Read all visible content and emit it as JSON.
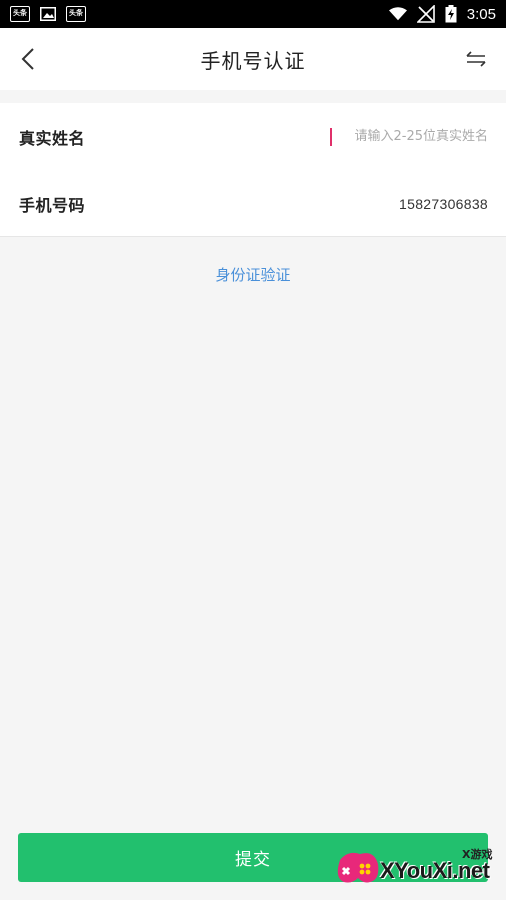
{
  "status_bar": {
    "notif_1": "头条",
    "notif_2": "头条",
    "time": "3:05"
  },
  "header": {
    "title": "手机号认证",
    "back_icon": "chevron-left-icon",
    "switch_icon": "switch-arrows-icon"
  },
  "form": {
    "name_label": "真实姓名",
    "name_placeholder": "请输入2-25位真实姓名",
    "name_value": "",
    "phone_label": "手机号码",
    "phone_value": "15827306838"
  },
  "id_verify_link": "身份证验证",
  "submit_label": "提交",
  "watermark": {
    "small": "X游戏",
    "text": "XYouXi.net"
  },
  "colors": {
    "primary": "#22c06e",
    "link": "#4a90d9",
    "caret": "#e0306a"
  }
}
